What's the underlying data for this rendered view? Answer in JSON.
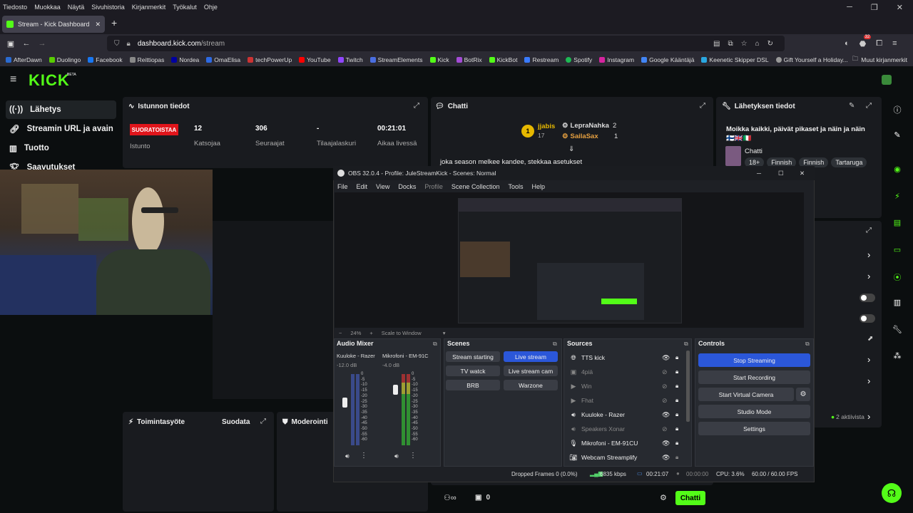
{
  "browser": {
    "menu": [
      "Tiedosto",
      "Muokkaa",
      "Näytä",
      "Sivuhistoria",
      "Kirjanmerkit",
      "Työkalut",
      "Ohje"
    ],
    "tab_title": "Stream - Kick Dashboard",
    "url_host": "dashboard.kick.com",
    "url_path": "/stream",
    "ext_badge": "32",
    "bookmarks": [
      "AfterDawn",
      "Duolingo",
      "Facebook",
      "Reittiopas",
      "Nordea",
      "OmaElisa",
      "techPowerUp",
      "YouTube",
      "Twitch",
      "StreamElements",
      "Kick",
      "BotRix",
      "KickBot",
      "Restream",
      "Spotify",
      "Instagram",
      "Google Kääntäjä",
      "Keenetic Skipper DSL",
      "Gift Yourself a Holiday..."
    ],
    "bookmarks_other": "Muut kirjanmerkit"
  },
  "kick": {
    "logo": "KICK",
    "beta": "BETA",
    "sidebar": [
      "Lähetys",
      "Streamin URL ja avain",
      "Tuotto",
      "Saavutukset"
    ],
    "session_panel": {
      "title": "Istunnon tiedot",
      "live_badge": "SUORATOISTAA",
      "status_label": "Istunto",
      "viewers_value": "12",
      "viewers_label": "Katsojaa",
      "followers_value": "306",
      "followers_label": "Seuraajat",
      "subs_value": "-",
      "subs_label": "Tilaajalaskuri",
      "time_value": "00:21:01",
      "time_label": "Aikaa livessä"
    },
    "chat_panel": {
      "title": "Chatti",
      "top_rank": "1",
      "top_user": "jjabis",
      "top_count": "17",
      "user2": "LepraNahka",
      "user2_count": "2",
      "user3": "SailaSax",
      "user3_count": "1",
      "message": "joka season melkee kandee, stekkaa asetukset"
    },
    "broadcast_panel": {
      "title": "Lähetyksen tiedot",
      "stream_title": "Moikka kaikki, päivät pikaset ja näin ja näin 🇫🇮🇬🇧🇮🇹",
      "category": "Chatti",
      "tags": [
        "18+",
        "Finnish",
        "Finnish",
        "Tartaruga"
      ]
    },
    "activity_title": "Toimintasyöte",
    "activity_filter": "Suodata",
    "moderation_title": "Moderointi",
    "active_count": "2 aktiivista",
    "chat_viewers": "0",
    "chat_button": "Chatti"
  },
  "obs": {
    "title": "OBS 32.0.4 - Profile: JuleStreamKick - Scenes: Normal",
    "menu": [
      "File",
      "Edit",
      "View",
      "Docks",
      "Profile",
      "Scene Collection",
      "Tools",
      "Help"
    ],
    "zoom": "24%",
    "scale_mode": "Scale to Window",
    "audio": {
      "title": "Audio Mixer",
      "channels": [
        {
          "name": "Kuuloke - Razer",
          "db": "-12.0 dB"
        },
        {
          "name": "Mikrofoni - EM-91C",
          "db": "-4.0 dB"
        }
      ],
      "scale": [
        "0",
        "-5",
        "-10",
        "-15",
        "-20",
        "-25",
        "-30",
        "-35",
        "-40",
        "-45",
        "-50",
        "-55",
        "-60"
      ]
    },
    "scenes": {
      "title": "Scenes",
      "items": [
        "Stream starting",
        "Live stream",
        "TV watck",
        "Live stream cam",
        "BRB",
        "Warzone"
      ],
      "selected": "Live stream"
    },
    "sources": {
      "title": "Sources",
      "items": [
        {
          "name": "TTS kick",
          "icon": "globe-icon",
          "visible": true
        },
        {
          "name": "4piä",
          "icon": "image-icon",
          "visible": false
        },
        {
          "name": "Win",
          "icon": "play-icon",
          "visible": false
        },
        {
          "name": "Fhat",
          "icon": "play-icon",
          "visible": false
        },
        {
          "name": "Kuuloke - Razer",
          "icon": "speaker-icon",
          "visible": true
        },
        {
          "name": "Speakers Xonar",
          "icon": "speaker-icon",
          "visible": false
        },
        {
          "name": "Mikrofoni - EM-91CU",
          "icon": "mic-icon",
          "visible": true
        },
        {
          "name": "Webcam Streamplify",
          "icon": "camera-icon",
          "visible": true
        }
      ]
    },
    "controls": {
      "title": "Controls",
      "buttons": [
        "Stop Streaming",
        "Start Recording",
        "Start Virtual Camera",
        "Studio Mode",
        "Settings"
      ]
    },
    "status": {
      "dropped": "Dropped Frames 0 (0.0%)",
      "bitrate": "6835 kbps",
      "stream_time": "00:21:07",
      "rec_time": "00:00:00",
      "cpu": "CPU: 3.6%",
      "fps": "60.00 / 60.00 FPS"
    }
  },
  "colors": {
    "kick_green": "#53fc18",
    "live_red": "#e0151b",
    "obs_blue": "#2b57d9"
  }
}
